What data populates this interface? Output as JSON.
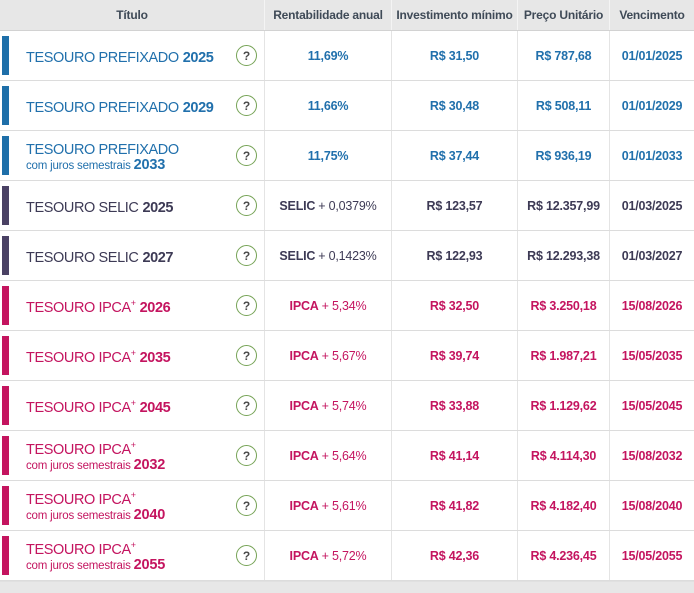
{
  "header": {
    "columns": [
      "Título",
      "Rentabilidade anual",
      "Investimento mínimo",
      "Preço Unitário",
      "Vencimento"
    ]
  },
  "help_icon": "?",
  "colors": {
    "prefixado_bar": "#1e6fa9",
    "prefixado_text": "#2170ac",
    "selic_bar": "#4a4164",
    "selic_text": "#3d3a55",
    "ipca_bar": "#c4145f",
    "ipca_text": "#c4145f",
    "header_bg": "#e7e7e7",
    "header_text": "#3f4a57",
    "row_divider": "#dcdcdc",
    "help_border": "#76a356",
    "help_text": "#4a4a4a"
  },
  "rows": [
    {
      "theme": "prefixado",
      "name": "TESOURO PREFIXADO",
      "sup": "",
      "year": "2025",
      "line2": "",
      "line2_year": "",
      "rate_bold": "11,69%",
      "rate_rest": "",
      "min_investment": "R$ 31,50",
      "unit_price": "R$ 787,68",
      "maturity": "01/01/2025"
    },
    {
      "theme": "prefixado",
      "name": "TESOURO PREFIXADO",
      "sup": "",
      "year": "2029",
      "line2": "",
      "line2_year": "",
      "rate_bold": "11,66%",
      "rate_rest": "",
      "min_investment": "R$ 30,48",
      "unit_price": "R$ 508,11",
      "maturity": "01/01/2029"
    },
    {
      "theme": "prefixado",
      "name": "TESOURO PREFIXADO",
      "sup": "",
      "year": "",
      "line2": "com juros semestrais",
      "line2_year": "2033",
      "rate_bold": "11,75%",
      "rate_rest": "",
      "min_investment": "R$ 37,44",
      "unit_price": "R$ 936,19",
      "maturity": "01/01/2033"
    },
    {
      "theme": "selic",
      "name": "TESOURO SELIC",
      "sup": "",
      "year": "2025",
      "line2": "",
      "line2_year": "",
      "rate_bold": "SELIC",
      "rate_rest": "+ 0,0379%",
      "min_investment": "R$ 123,57",
      "unit_price": "R$ 12.357,99",
      "maturity": "01/03/2025"
    },
    {
      "theme": "selic",
      "name": "TESOURO SELIC",
      "sup": "",
      "year": "2027",
      "line2": "",
      "line2_year": "",
      "rate_bold": "SELIC",
      "rate_rest": "+ 0,1423%",
      "min_investment": "R$ 122,93",
      "unit_price": "R$ 12.293,38",
      "maturity": "01/03/2027"
    },
    {
      "theme": "ipca",
      "name": "TESOURO IPCA",
      "sup": "+",
      "year": "2026",
      "line2": "",
      "line2_year": "",
      "rate_bold": "IPCA",
      "rate_rest": "+ 5,34%",
      "min_investment": "R$ 32,50",
      "unit_price": "R$ 3.250,18",
      "maturity": "15/08/2026"
    },
    {
      "theme": "ipca",
      "name": "TESOURO IPCA",
      "sup": "+",
      "year": "2035",
      "line2": "",
      "line2_year": "",
      "rate_bold": "IPCA",
      "rate_rest": "+ 5,67%",
      "min_investment": "R$ 39,74",
      "unit_price": "R$ 1.987,21",
      "maturity": "15/05/2035"
    },
    {
      "theme": "ipca",
      "name": "TESOURO IPCA",
      "sup": "+",
      "year": "2045",
      "line2": "",
      "line2_year": "",
      "rate_bold": "IPCA",
      "rate_rest": "+ 5,74%",
      "min_investment": "R$ 33,88",
      "unit_price": "R$ 1.129,62",
      "maturity": "15/05/2045"
    },
    {
      "theme": "ipca",
      "name": "TESOURO IPCA",
      "sup": "+",
      "year": "",
      "line2": "com juros semestrais",
      "line2_year": "2032",
      "rate_bold": "IPCA",
      "rate_rest": "+ 5,64%",
      "min_investment": "R$ 41,14",
      "unit_price": "R$ 4.114,30",
      "maturity": "15/08/2032"
    },
    {
      "theme": "ipca",
      "name": "TESOURO IPCA",
      "sup": "+",
      "year": "",
      "line2": "com juros semestrais",
      "line2_year": "2040",
      "rate_bold": "IPCA",
      "rate_rest": "+ 5,61%",
      "min_investment": "R$ 41,82",
      "unit_price": "R$ 4.182,40",
      "maturity": "15/08/2040"
    },
    {
      "theme": "ipca",
      "name": "TESOURO IPCA",
      "sup": "+",
      "year": "",
      "line2": "com juros semestrais",
      "line2_year": "2055",
      "rate_bold": "IPCA",
      "rate_rest": "+ 5,72%",
      "min_investment": "R$ 42,36",
      "unit_price": "R$ 4.236,45",
      "maturity": "15/05/2055"
    }
  ]
}
